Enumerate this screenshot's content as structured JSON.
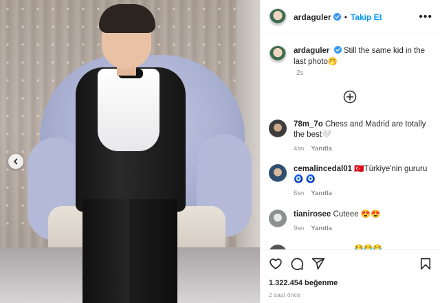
{
  "post": {
    "author": "ardaguler",
    "follow_label": "Takip Et",
    "more_label": "•••",
    "caption_text": "Still the same kid in the last photo🤭",
    "caption_time": "2s"
  },
  "comments": [
    {
      "user": "78m_7o",
      "text": "Chess and Madrid are totally the best🤍",
      "time": "4sn",
      "reply": "Yanıtla"
    },
    {
      "user": "cemalincedal01",
      "text": "🇹🇷Türkiye'nin gururu 🧿 🧿",
      "time": "6sn",
      "reply": "Yanıtla"
    },
    {
      "user": "tianirosee",
      "text": "Cuteee 😍😍",
      "time": "9sn",
      "reply": "Yanıtla"
    },
    {
      "user": "",
      "text": "😂😂😂",
      "time": "",
      "reply": ""
    }
  ],
  "footer": {
    "likes": "1.322.454 beğenme",
    "ago": "2 saat önce"
  },
  "colors": {
    "accent": "#0095f6",
    "verified": "#3897f0",
    "muted": "#8e8e8e"
  },
  "icons": [
    "chevron-left-icon",
    "verified-badge-icon",
    "plus-circle-icon",
    "heart-icon",
    "comment-icon",
    "share-icon",
    "bookmark-icon"
  ]
}
